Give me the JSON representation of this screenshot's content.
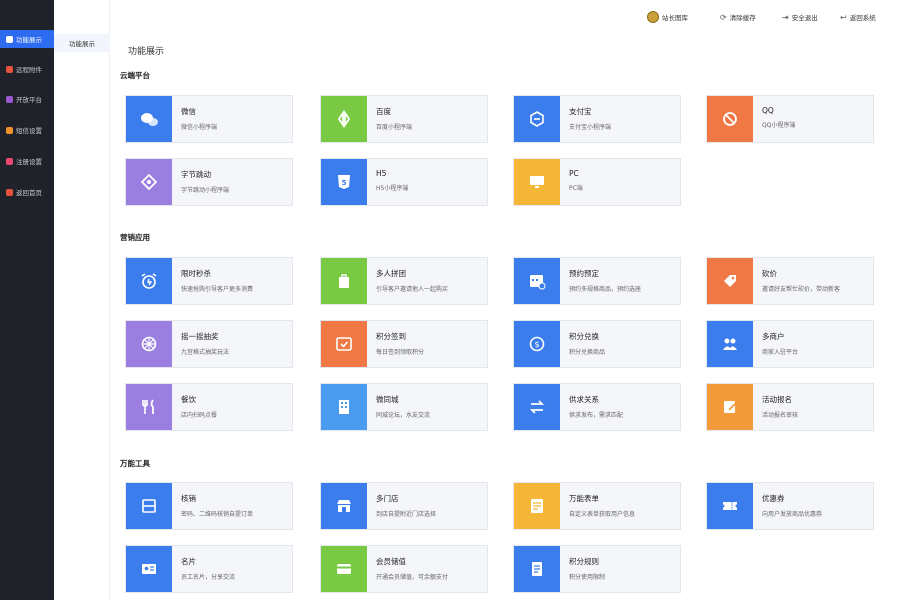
{
  "sidebar": {
    "items": [
      {
        "label": "功能展示",
        "color": "#2d6cf0"
      },
      {
        "label": "远程附件",
        "color": "#e5533d"
      },
      {
        "label": "开放平台",
        "color": "#9b59d0"
      },
      {
        "label": "短信设置",
        "color": "#f0932b"
      },
      {
        "label": "注册设置",
        "color": "#e84a6f"
      },
      {
        "label": "返回首页",
        "color": "#e5533d"
      }
    ]
  },
  "subnav": {
    "label": "功能展示"
  },
  "header": {
    "user": "站长图库",
    "clear_cache": "清除缓存",
    "logout": "安全退出",
    "back": "返回系统"
  },
  "page": {
    "title": "功能展示"
  },
  "colors": {
    "blue": "#3b7ded",
    "green": "#7ac943",
    "orange": "#f07845",
    "purple": "#9b7fe0",
    "yellow": "#f6b637",
    "sky": "#4b9cf0",
    "amber": "#f39b3a"
  },
  "sections": [
    {
      "title": "云端平台",
      "cards": [
        {
          "name": "微信",
          "desc": "微信小程序端",
          "color": "#3b7ded",
          "icon": "wechat-icon"
        },
        {
          "name": "百度",
          "desc": "百度小程序端",
          "color": "#7ac943",
          "icon": "baidu-icon"
        },
        {
          "name": "支付宝",
          "desc": "支付宝小程序端",
          "color": "#3b7ded",
          "icon": "alipay-icon"
        },
        {
          "name": "QQ",
          "desc": "QQ小程序端",
          "color": "#f07845",
          "icon": "qq-icon"
        },
        {
          "name": "字节跳动",
          "desc": "字节跳动小程序端",
          "color": "#9b7fe0",
          "icon": "bytedance-icon"
        },
        {
          "name": "H5",
          "desc": "H5小程序端",
          "color": "#3b7ded",
          "icon": "html5-icon"
        },
        {
          "name": "PC",
          "desc": "PC端",
          "color": "#f6b637",
          "icon": "monitor-icon"
        }
      ]
    },
    {
      "title": "营销应用",
      "cards": [
        {
          "name": "限时秒杀",
          "desc": "快速抢购引导客户更多消费",
          "color": "#3b7ded",
          "icon": "alarm-clock-icon"
        },
        {
          "name": "多人拼团",
          "desc": "引导客户邀请他人一起购买",
          "color": "#7ac943",
          "icon": "group-buy-icon"
        },
        {
          "name": "预约预定",
          "desc": "预约多规格商品，预约选座",
          "color": "#3b7ded",
          "icon": "calendar-icon"
        },
        {
          "name": "砍价",
          "desc": "邀请好友帮忙砍价，带动新客",
          "color": "#f07845",
          "icon": "price-tag-icon"
        },
        {
          "name": "摇一摇抽奖",
          "desc": "九宫格式抽奖玩法",
          "color": "#9b7fe0",
          "icon": "lottery-icon"
        },
        {
          "name": "积分签到",
          "desc": "每日签到领取积分",
          "color": "#f07845",
          "icon": "checkin-icon"
        },
        {
          "name": "积分兑换",
          "desc": "积分兑换商品",
          "color": "#3b7ded",
          "icon": "coin-icon"
        },
        {
          "name": "多商户",
          "desc": "商家入驻平台",
          "color": "#3b7ded",
          "icon": "merchants-icon"
        },
        {
          "name": "餐饮",
          "desc": "店内扫码点餐",
          "color": "#9b7fe0",
          "icon": "cutlery-icon"
        },
        {
          "name": "微同城",
          "desc": "同城论坛，水友交流",
          "color": "#4b9cf0",
          "icon": "building-icon"
        },
        {
          "name": "供求关系",
          "desc": "供求发布，需求匹配",
          "color": "#3b7ded",
          "icon": "exchange-icon"
        },
        {
          "name": "活动报名",
          "desc": "活动报名审核",
          "color": "#f39b3a",
          "icon": "edit-form-icon"
        }
      ]
    },
    {
      "title": "万能工具",
      "cards": [
        {
          "name": "核销",
          "desc": "密码、二维码核销自提订单",
          "color": "#3b7ded",
          "icon": "scan-icon"
        },
        {
          "name": "多门店",
          "desc": "到店自提附近门店选择",
          "color": "#3b7ded",
          "icon": "store-icon"
        },
        {
          "name": "万能表单",
          "desc": "自定义表单获取用户信息",
          "color": "#f6b637",
          "icon": "form-icon"
        },
        {
          "name": "优惠券",
          "desc": "向用户发放商品优惠券",
          "color": "#3b7ded",
          "icon": "coupon-icon"
        },
        {
          "name": "名片",
          "desc": "员工名片，分享交流",
          "color": "#3b7ded",
          "icon": "id-card-icon"
        },
        {
          "name": "会员储值",
          "desc": "开通会员储值，可余额支付",
          "color": "#7ac943",
          "icon": "card-icon"
        },
        {
          "name": "积分规则",
          "desc": "积分使用限制",
          "color": "#3b7ded",
          "icon": "rules-icon"
        }
      ]
    }
  ]
}
